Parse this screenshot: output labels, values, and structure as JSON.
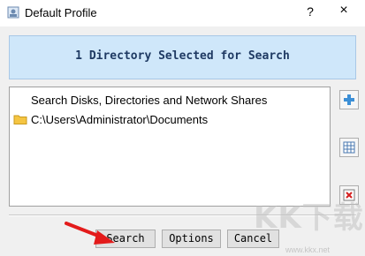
{
  "window": {
    "title": "Default Profile",
    "help_label": "?",
    "close_label": "×"
  },
  "banner": {
    "text": "1 Directory Selected for Search"
  },
  "list": {
    "items": [
      {
        "label": "Search Disks, Directories and Network Shares",
        "icon": "none"
      },
      {
        "label": "C:\\Users\\Administrator\\Documents",
        "icon": "folder-icon"
      }
    ]
  },
  "side_buttons": [
    {
      "name": "add-button",
      "icon": "plus-icon"
    },
    {
      "name": "select-button",
      "icon": "grid-icon"
    },
    {
      "name": "remove-button",
      "icon": "delete-icon"
    }
  ],
  "buttons": {
    "search_label": "Search",
    "options_label": "Options",
    "cancel_label": "Cancel"
  },
  "watermark": {
    "brand": "KK下载",
    "url": "www.kkx.net"
  },
  "colors": {
    "banner_bg": "#cfe7fa",
    "banner_text": "#1f3a63",
    "arrow": "#e31b1b",
    "folder": "#f5c542"
  }
}
